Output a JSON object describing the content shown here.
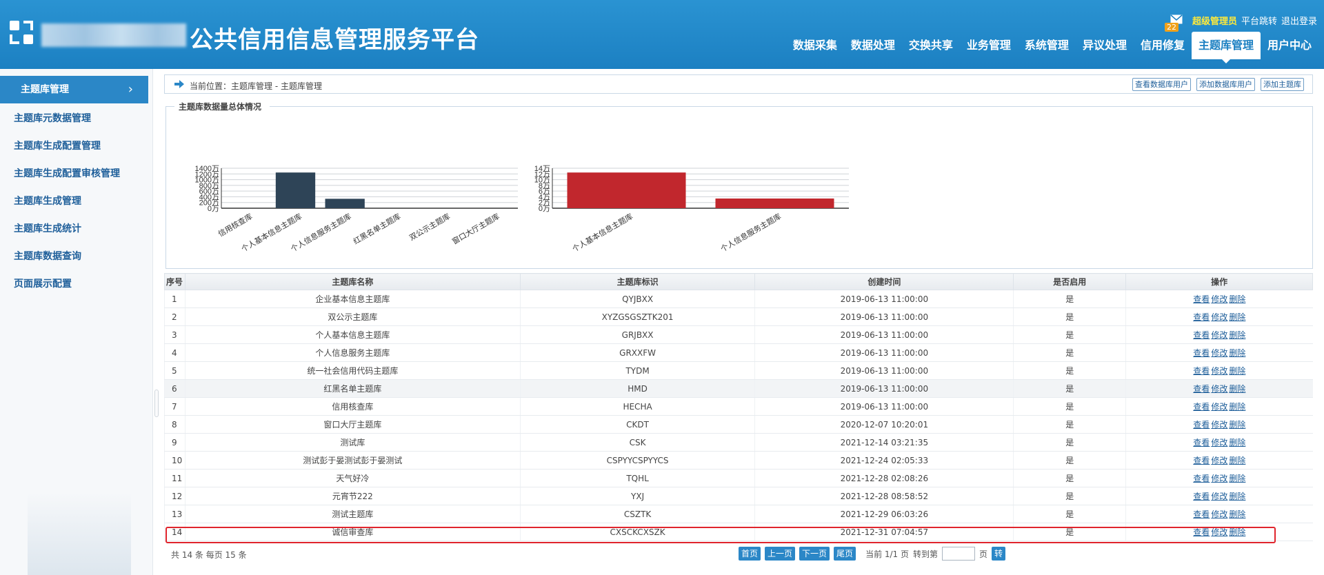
{
  "header": {
    "title": "公共信用信息管理服务平台",
    "admin": "超级管理员",
    "switch_platform": "平台跳转",
    "logout": "退出登录",
    "mail_count": "22",
    "nav": [
      "数据采集",
      "数据处理",
      "交换共享",
      "业务管理",
      "系统管理",
      "异议处理",
      "信用修复",
      "主题库管理",
      "用户中心"
    ],
    "active_nav": "主题库管理"
  },
  "sidebar": {
    "head": "主题库管理",
    "items": [
      "主题库元数据管理",
      "主题库生成配置管理",
      "主题库生成配置审核管理",
      "主题库生成管理",
      "主题库生成统计",
      "主题库数据查询",
      "页面展示配置"
    ]
  },
  "breadcrumb": {
    "text": "当前位置：主题库管理 - 主题库管理",
    "btn_view_users": "查看数据库用户",
    "btn_add_user": "添加数据库用户",
    "btn_add_lib": "添加主题库"
  },
  "chart_section": {
    "legend": "主题库数据量总体情况"
  },
  "chart_data": [
    {
      "type": "bar",
      "categories": [
        "信用核查库",
        "个人基本信息主题库",
        "个人信息服务主题库",
        "红黑名单主题库",
        "双公示主题库",
        "窗口大厅主题库"
      ],
      "values": [
        0,
        1250,
        330,
        0,
        0,
        0
      ],
      "yticks": [
        "0万",
        "200万",
        "400万",
        "600万",
        "800万",
        "1000万",
        "1200万",
        "1400万"
      ],
      "ylim": [
        0,
        1400
      ],
      "color": "#2e4457"
    },
    {
      "type": "bar",
      "categories": [
        "个人基本信息主题库",
        "个人信息服务主题库"
      ],
      "values": [
        12.5,
        3.4
      ],
      "yticks": [
        "0万",
        "2万",
        "4万",
        "6万",
        "8万",
        "10万",
        "12万",
        "14万"
      ],
      "ylim": [
        0,
        14
      ],
      "color": "#c1272d"
    }
  ],
  "table": {
    "headers": [
      "序号",
      "主题库名称",
      "主题库标识",
      "创建时间",
      "是否启用",
      "操作"
    ],
    "op_labels": [
      "查看",
      "修改",
      "删除"
    ],
    "rows": [
      [
        "1",
        "企业基本信息主题库",
        "QYJBXX",
        "2019-06-13 11:00:00",
        "是"
      ],
      [
        "2",
        "双公示主题库",
        "XYZGSGSZTK201",
        "2019-06-13 11:00:00",
        "是"
      ],
      [
        "3",
        "个人基本信息主题库",
        "GRJBXX",
        "2019-06-13 11:00:00",
        "是"
      ],
      [
        "4",
        "个人信息服务主题库",
        "GRXXFW",
        "2019-06-13 11:00:00",
        "是"
      ],
      [
        "5",
        "统一社会信用代码主题库",
        "TYDM",
        "2019-06-13 11:00:00",
        "是"
      ],
      [
        "6",
        "红黑名单主题库",
        "HMD",
        "2019-06-13 11:00:00",
        "是"
      ],
      [
        "7",
        "信用核查库",
        "HECHA",
        "2019-06-13 11:00:00",
        "是"
      ],
      [
        "8",
        "窗口大厅主题库",
        "CKDT",
        "2020-12-07 10:20:01",
        "是"
      ],
      [
        "9",
        "测试库",
        "CSK",
        "2021-12-14 03:21:35",
        "是"
      ],
      [
        "10",
        "测试彭于晏测试彭于晏测试",
        "CSPYYCSPYYCS",
        "2021-12-24 02:05:33",
        "是"
      ],
      [
        "11",
        "天气好冷",
        "TQHL",
        "2021-12-28 02:08:26",
        "是"
      ],
      [
        "12",
        "元宵节222",
        "YXJ",
        "2021-12-28 08:58:52",
        "是"
      ],
      [
        "13",
        "测试主题库",
        "CSZTK",
        "2021-12-29 06:03:26",
        "是"
      ],
      [
        "14",
        "诚信审查库",
        "CXSCKCXSZK",
        "2021-12-31 07:04:57",
        "是"
      ]
    ]
  },
  "pager": {
    "info": "共 14 条  每页  15  条",
    "first": "首页",
    "prev": "上一页",
    "next": "下一页",
    "last": "尾页",
    "current": "当前 1/1 页",
    "goto": "转到第",
    "page_unit": "页",
    "go": "转"
  }
}
